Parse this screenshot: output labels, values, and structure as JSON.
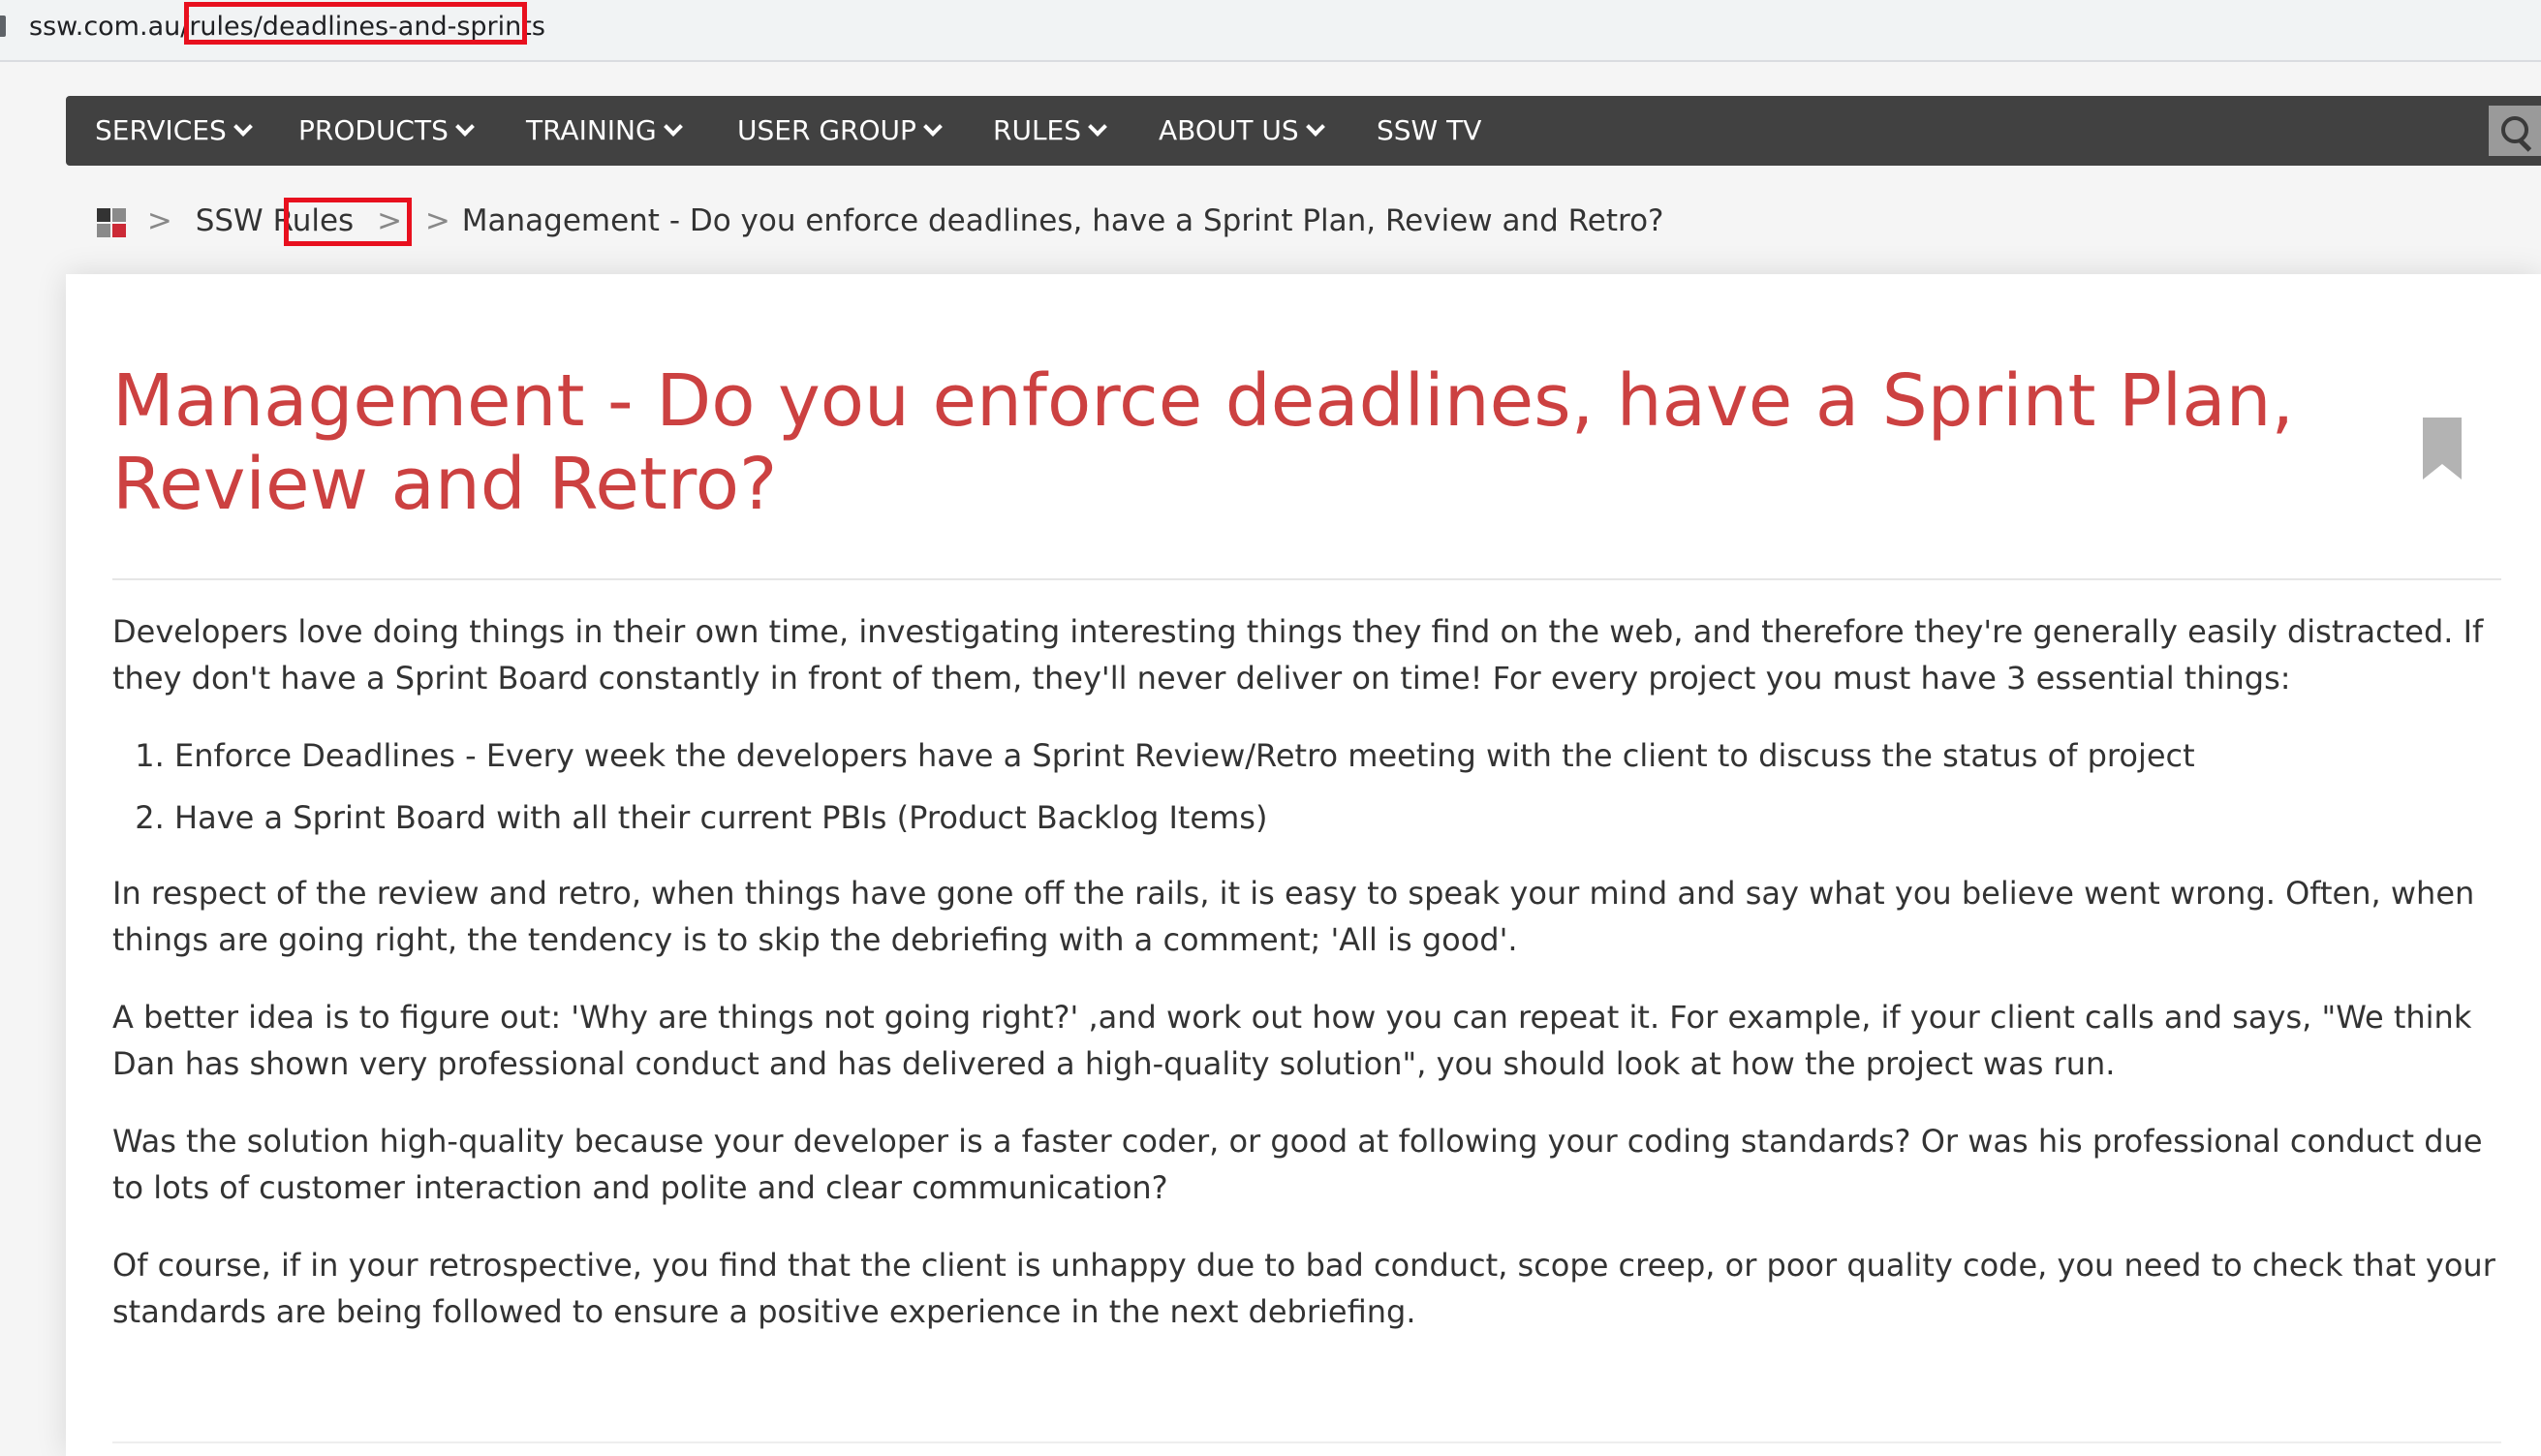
{
  "browser": {
    "url": "ssw.com.au/rules/deadlines-and-sprints"
  },
  "nav": {
    "items": [
      {
        "label": "SERVICES",
        "has_dropdown": true
      },
      {
        "label": "PRODUCTS",
        "has_dropdown": true
      },
      {
        "label": "TRAINING",
        "has_dropdown": true
      },
      {
        "label": "USER GROUP",
        "has_dropdown": true
      },
      {
        "label": "RULES",
        "has_dropdown": true
      },
      {
        "label": "ABOUT US",
        "has_dropdown": true
      },
      {
        "label": "SSW TV",
        "has_dropdown": false
      }
    ],
    "search_icon": "search-icon"
  },
  "breadcrumb": {
    "home_icon": "ssw-logo-icon",
    "separator": ">",
    "root": "SSW Rules",
    "current": "Management - Do you enforce deadlines, have a Sprint Plan, Review and Retro?"
  },
  "rule": {
    "title": "Management - Do you enforce deadlines, have a Sprint Plan, Review and Retro?",
    "bookmark_icon": "bookmark-icon",
    "intro": "Developers love doing things in their own time, investigating interesting things they find on the web, and therefore they're generally easily distracted. If they don't have a Sprint Board constantly in front of them, they'll never deliver on time! For every project you must have 3 essential things:",
    "list": [
      "Enforce Deadlines - Every week the developers have a Sprint Review/Retro meeting with the client to discuss the status of project",
      "Have a Sprint Board with all their current PBIs (Product Backlog Items)"
    ],
    "paragraphs": [
      "In respect of the review and retro, when things have gone off the rails, it is easy to speak your mind and say what you believe went wrong. Often, when things are going right, the tendency is to skip the debriefing with a comment; 'All is good'.",
      "A better idea is to figure out: 'Why are things not going right?' ,and work out how you can repeat it. For example, if your client calls and says, \"We think Dan has shown very professional conduct and has delivered a high-quality solution\", you should look at how the project was run.",
      "Was the solution high-quality because your developer is a faster coder, or good at following your coding standards? Or was his professional conduct due to lots of customer interaction and polite and clear communication?",
      "Of course, if in your retrospective, you find that the client is unhappy due to bad conduct, scope creep, or poor quality code, you need to check that your standards are being followed to ensure a positive experience in the next debriefing."
    ]
  },
  "colors": {
    "nav_background": "#414141",
    "title_red": "#cc4141",
    "highlight_red": "#e8101e"
  }
}
